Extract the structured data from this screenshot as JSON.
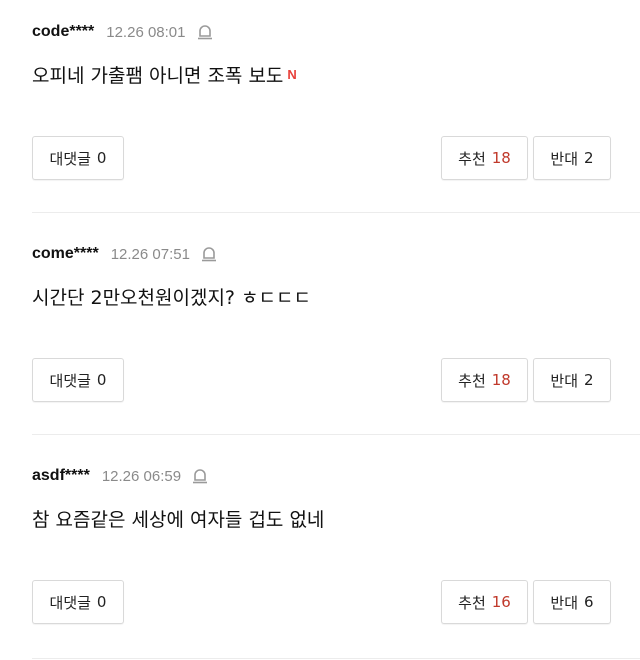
{
  "comments": [
    {
      "user": "code****",
      "time": "12.26 08:01",
      "text": "오피네 가출팸 아니면 조폭 보도",
      "badge": "N",
      "reply_label": "대댓글",
      "reply_count": "0",
      "like_label": "추천",
      "like_count": "18",
      "dislike_label": "반대",
      "dislike_count": "2"
    },
    {
      "user": "come****",
      "time": "12.26 07:51",
      "text": "시간단 2만오천원이겠지? ㅎㄷㄷㄷ",
      "reply_label": "대댓글",
      "reply_count": "0",
      "like_label": "추천",
      "like_count": "18",
      "dislike_label": "반대",
      "dislike_count": "2"
    },
    {
      "user": "asdf****",
      "time": "12.26 06:59",
      "text": "참 요즘같은 세상에 여자들 겁도 없네",
      "reply_label": "대댓글",
      "reply_count": "0",
      "like_label": "추천",
      "like_count": "16",
      "dislike_label": "반대",
      "dislike_count": "6"
    }
  ],
  "colors": {
    "recommend_count": "#c0392b",
    "badge": "#e8413b",
    "meta": "#8a8a8a"
  },
  "icons": {
    "report": "bell-icon"
  }
}
